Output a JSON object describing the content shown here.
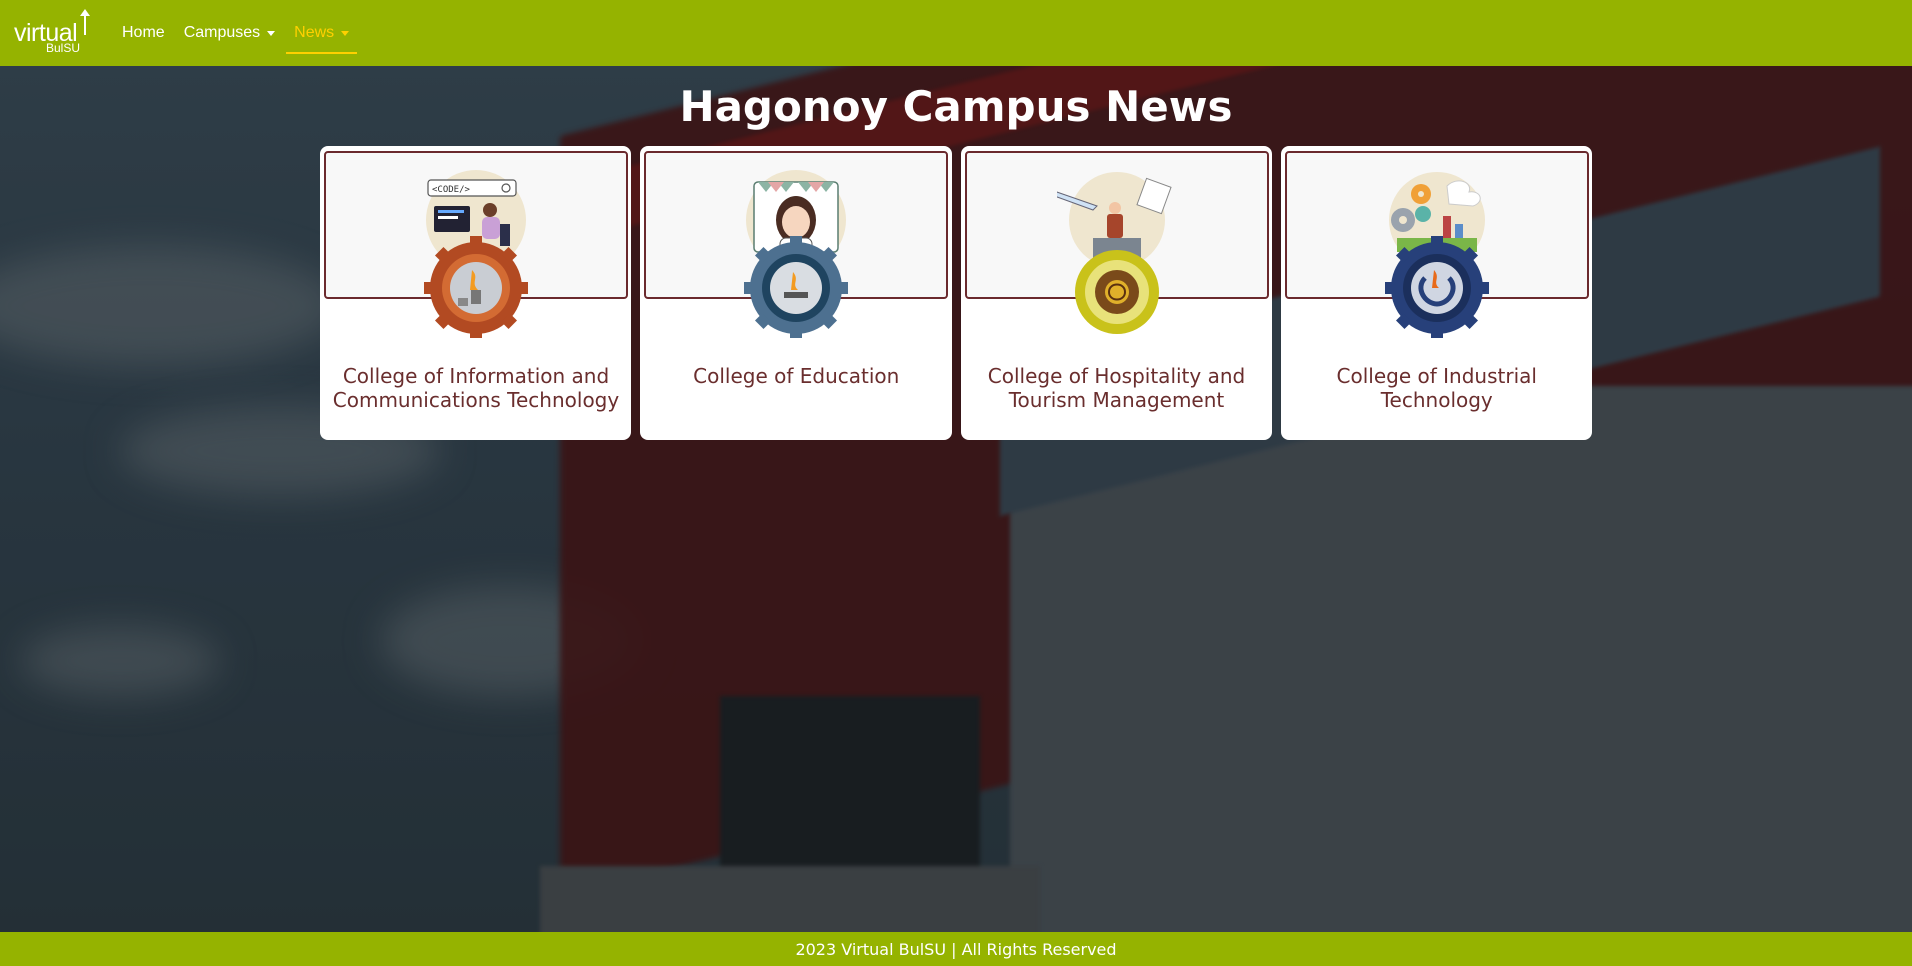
{
  "brand": {
    "word": "virtual",
    "sub": "BulSU"
  },
  "nav": {
    "items": [
      {
        "label": "Home",
        "dropdown": false,
        "active": false
      },
      {
        "label": "Campuses",
        "dropdown": true,
        "active": false
      },
      {
        "label": "News",
        "dropdown": true,
        "active": true
      }
    ],
    "active_color": "#ffd000"
  },
  "page": {
    "title": "Hagonoy Campus News"
  },
  "colleges": [
    {
      "name": "College of Information and Communications Technology",
      "icon": "cict-gear-seal-icon",
      "seal_color": "#b24a22"
    },
    {
      "name": "College of Education",
      "icon": "coed-gear-seal-icon",
      "seal_color": "#4d7090"
    },
    {
      "name": "College of Hospitality and Tourism Management",
      "icon": "chtm-seal-icon",
      "seal_color": "#c9c21a"
    },
    {
      "name": "College of Industrial Technology",
      "icon": "cit-gear-seal-icon",
      "seal_color": "#27407a"
    }
  ],
  "footer": {
    "text": "2023 Virtual BulSU | All Rights Reserved"
  },
  "theme": {
    "brand_green": "#95b300",
    "card_title": "#6a2e2e",
    "card_border": "#6b2a2e"
  }
}
